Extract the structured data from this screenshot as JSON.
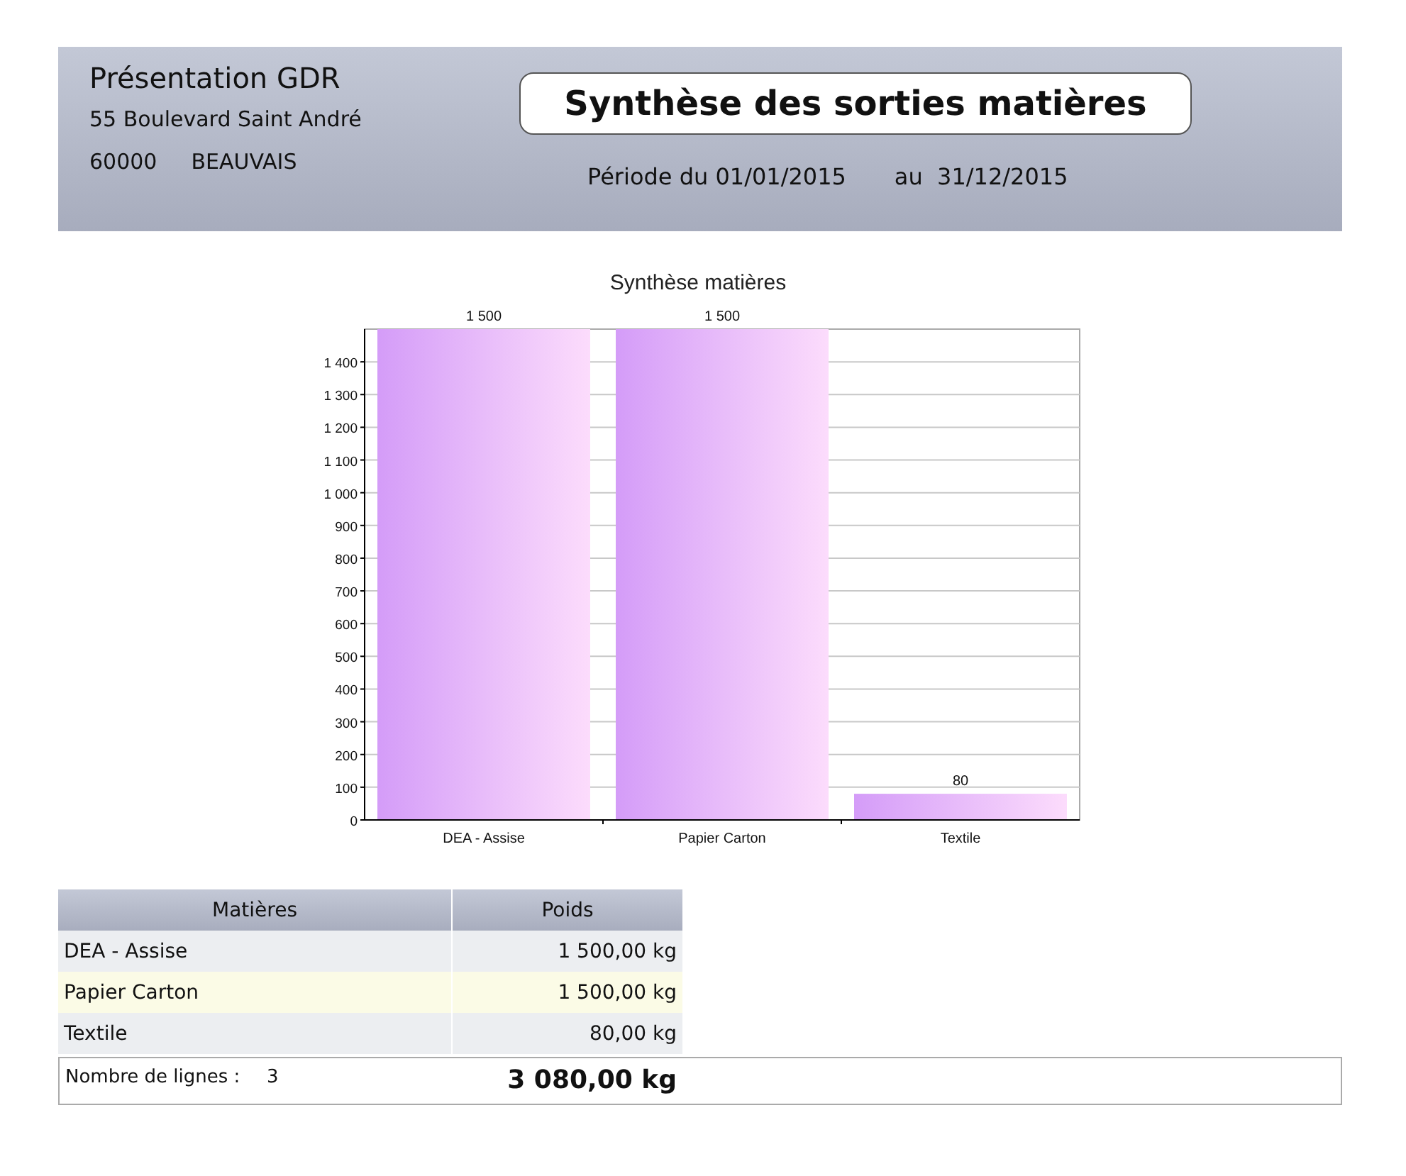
{
  "header": {
    "company": "Présentation GDR",
    "address": "55 Boulevard Saint André",
    "postcode": "60000",
    "city": "BEAUVAIS",
    "title": "Synthèse des sorties matières",
    "period_label": "Période du 01/01/2015",
    "period_end": "au  31/12/2015"
  },
  "chart": {
    "chart_data": {
      "type": "bar",
      "title": "Synthèse matières",
      "categories": [
        "DEA - Assise",
        "Papier Carton",
        "Textile"
      ],
      "series": [
        {
          "color": "#d49cf8",
          "values": [
            1500,
            1500,
            80
          ]
        }
      ],
      "grid": true,
      "ylim": [
        0,
        1500
      ],
      "yticks": [
        0,
        100,
        200,
        300,
        400,
        500,
        600,
        700,
        800,
        900,
        {
          "value": 1000,
          "label": "1 000"
        },
        {
          "value": 1100,
          "label": "1 100"
        },
        {
          "value": 1200,
          "label": "1 200"
        },
        {
          "value": 1300,
          "label": "1 300"
        },
        {
          "value": 1400,
          "label": "1 400"
        }
      ],
      "value_labels": [
        "1 500",
        "1 500",
        "80"
      ]
    }
  },
  "table": {
    "columns": [
      "Matières",
      "Poids"
    ],
    "rows": [
      {
        "cells": [
          "DEA - Assise",
          "1 500,00 kg"
        ]
      },
      {
        "cells": [
          "Papier Carton",
          "1 500,00 kg"
        ]
      },
      {
        "cells": [
          "Textile",
          "80,00 kg"
        ]
      }
    ]
  },
  "footer": {
    "count_label": "Nombre de lignes :",
    "count": "3",
    "total": "3 080,00 kg"
  }
}
